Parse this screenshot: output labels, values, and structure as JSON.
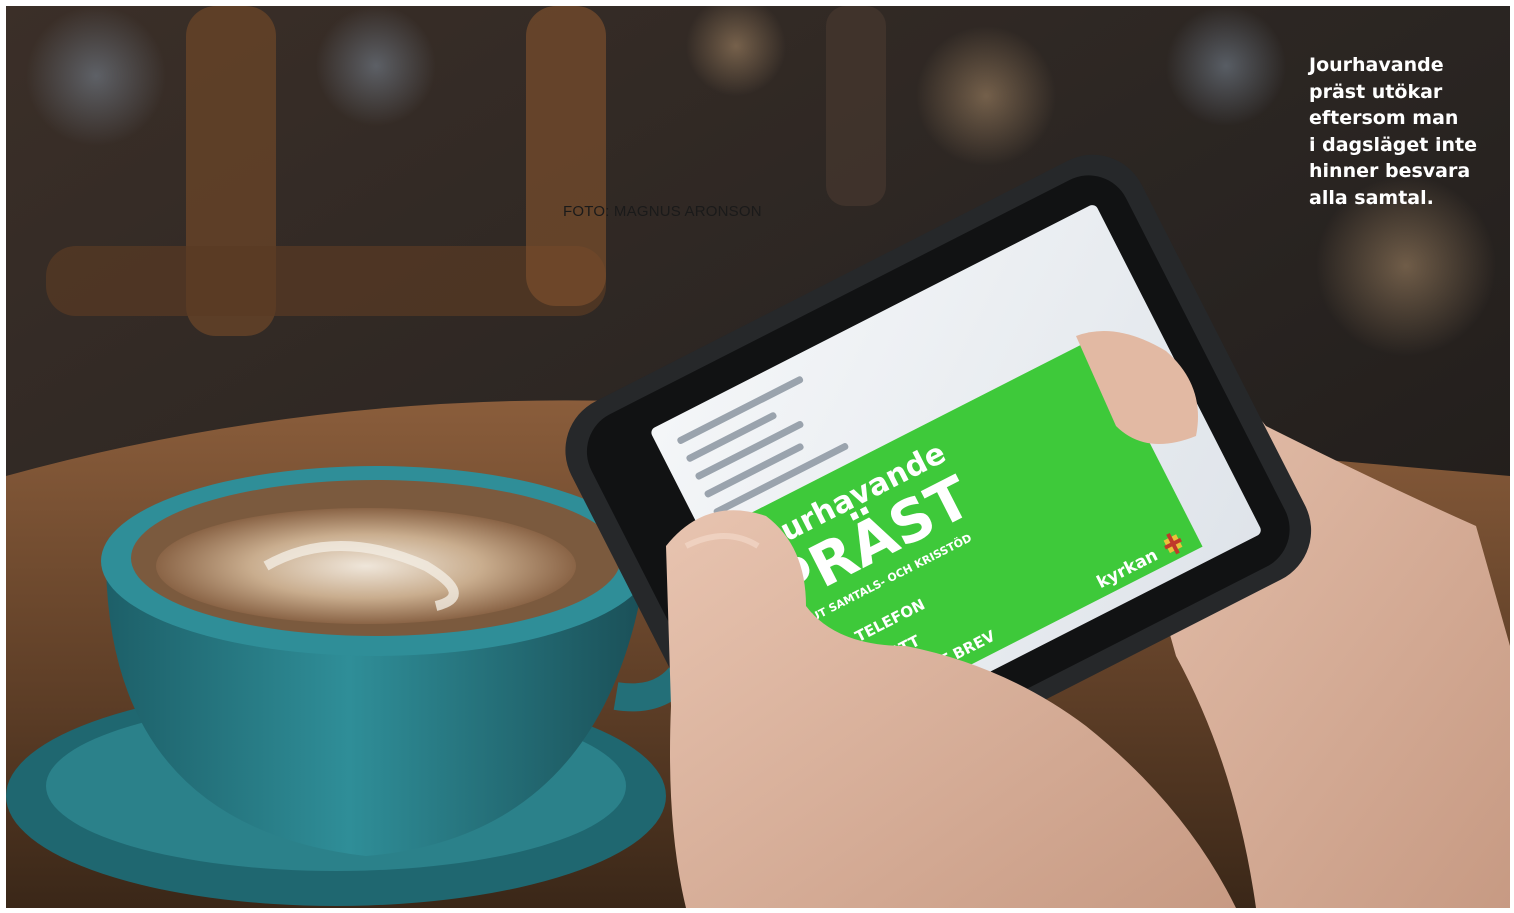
{
  "photo": {
    "credit": "FOTO: MAGNUS ARONSON",
    "caption_lines": [
      "Jourhavande",
      "präst utökar",
      "eftersom man",
      "i dagsläget inte",
      "hinner besvara",
      "alla samtal."
    ],
    "phone_screen": {
      "banner_line1": "Jourhavande",
      "banner_line2": "PRÄST",
      "banner_sub": "AKUT SAMTALS- OCH KRISSTÖD",
      "channels": [
        "TELEFON",
        "CHATT",
        "DIGITALT BREV"
      ],
      "brand": "kyrkan"
    },
    "colors": {
      "banner_green": "#3ec93a",
      "cup_teal": "#2d8a93",
      "table_brown": "#6e4a2e",
      "background_dark": "#2a211c"
    }
  }
}
